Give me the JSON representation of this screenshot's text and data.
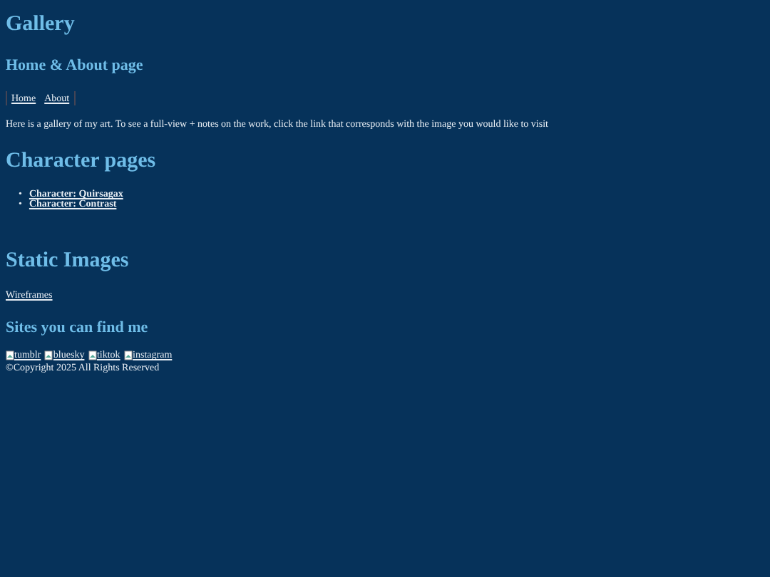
{
  "title": "Gallery",
  "nav_heading": "Home & About page",
  "nav_links": [
    "Home",
    "About"
  ],
  "intro": "Here is a gallery of my art. To see a full-view + notes on the work, click the link that corresponds with the image you would like to visit",
  "character_heading": "Character pages",
  "character_links": [
    {
      "marker": "•",
      "label": "Character: Quirsagax"
    },
    {
      "marker": "•",
      "label": "Character: Contrast"
    }
  ],
  "static_heading": "Static Images",
  "static_links": [
    "Wireframes"
  ],
  "sites_heading": "Sites you can find me",
  "site_links": [
    "tumblr",
    "bluesky",
    "tiktok",
    "instagram"
  ],
  "copyright": "©Copyright 2025 All Rights Reserved"
}
